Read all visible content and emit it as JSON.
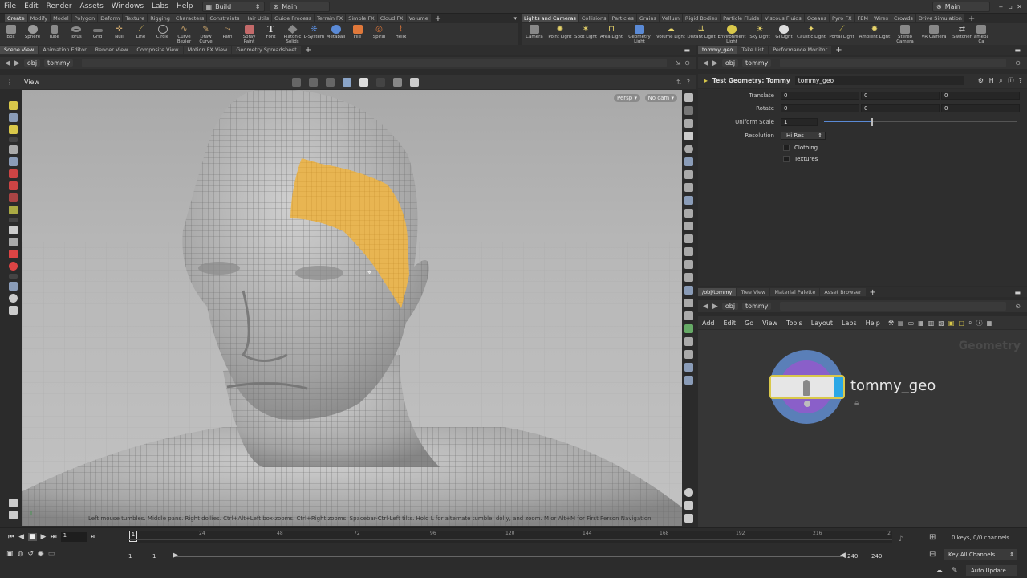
{
  "menubar": {
    "items": [
      "File",
      "Edit",
      "Render",
      "Assets",
      "Windows",
      "Labs",
      "Help"
    ],
    "desktop": "Build",
    "context": "Main",
    "right_context": "Main"
  },
  "shelf_left": {
    "tabs": [
      "Create",
      "Modify",
      "Model",
      "Polygon",
      "Deform",
      "Texture",
      "Rigging",
      "Characters",
      "Constraints",
      "Hair Utils",
      "Guide Process",
      "Terrain FX",
      "Simple FX",
      "Cloud FX",
      "Volume"
    ],
    "tools": [
      "Box",
      "Sphere",
      "Tube",
      "Torus",
      "Grid",
      "Null",
      "Line",
      "Circle",
      "Curve Bezier",
      "Draw Curve",
      "Path",
      "Spray Paint",
      "Font",
      "Platonic Solids",
      "L-System",
      "Metaball",
      "File",
      "Spiral",
      "Helix"
    ]
  },
  "shelf_right": {
    "tabs": [
      "Lights and Cameras",
      "Collisions",
      "Particles",
      "Grains",
      "Vellum",
      "Rigid Bodies",
      "Particle Fluids",
      "Viscous Fluids",
      "Oceans",
      "Pyro FX",
      "FEM",
      "Wires",
      "Crowds",
      "Drive Simulation"
    ],
    "tools": [
      "Camera",
      "Point Light",
      "Spot Light",
      "Area Light",
      "Geometry Light",
      "Volume Light",
      "Distant Light",
      "Environment Light",
      "Sky Light",
      "GI Light",
      "Caustic Light",
      "Portal Light",
      "Ambient Light",
      "Stereo Camera",
      "VR Camera",
      "Switcher",
      "Gamepad Ca"
    ]
  },
  "viewer": {
    "tabs": [
      "Scene View",
      "Animation Editor",
      "Render View",
      "Composite View",
      "Motion FX View",
      "Geometry Spreadsheet"
    ],
    "path": [
      "obj",
      "tommy"
    ],
    "label": "View",
    "persp": "Persp",
    "cam": "No cam",
    "hint": "Left mouse tumbles. Middle pans. Right dollies. Ctrl+Alt+Left box-zooms. Ctrl+Right zooms. Spacebar-Ctrl-Left tilts. Hold L for alternate tumble, dolly, and zoom.    M or Alt+M for First Person Navigation."
  },
  "params": {
    "tabs": [
      "tommy_geo",
      "Take List",
      "Performance Monitor"
    ],
    "path": [
      "obj",
      "tommy"
    ],
    "node_type": "Test Geometry: Tommy",
    "node_name": "tommy_geo",
    "translate_label": "Translate",
    "translate": [
      "0",
      "0",
      "0"
    ],
    "rotate_label": "Rotate",
    "rotate": [
      "0",
      "0",
      "0"
    ],
    "scale_label": "Uniform Scale",
    "scale": "1",
    "scale_level": 0.25,
    "res_label": "Resolution",
    "res": "Hi Res",
    "clothing": "Clothing",
    "textures": "Textures"
  },
  "network": {
    "tabs": [
      "/obj/tommy",
      "Tree View",
      "Material Palette",
      "Asset Browser"
    ],
    "path": [
      "obj",
      "tommy"
    ],
    "menu": [
      "Add",
      "Edit",
      "Go",
      "View",
      "Tools",
      "Layout",
      "Labs",
      "Help"
    ],
    "context_label": "Geometry",
    "node_name": "tommy_geo"
  },
  "timeline": {
    "frame": "1",
    "ticks": [
      "24",
      "48",
      "72",
      "96",
      "120",
      "144",
      "168",
      "192",
      "216"
    ],
    "current_marker": "1",
    "end_tick": "2",
    "start": "1",
    "range_start": "1",
    "range_end": "240",
    "end": "240",
    "keys": "0 keys, 0/0 channels",
    "key_all": "Key All Channels",
    "update": "Auto Update"
  },
  "colors": {
    "accent_selection": "#e8b552",
    "node_ring_outer": "#5a7fb8",
    "node_ring_inner": "#8a5fc9",
    "node_flag": "#2aa7e6",
    "node_frame": "#d9c84a"
  }
}
